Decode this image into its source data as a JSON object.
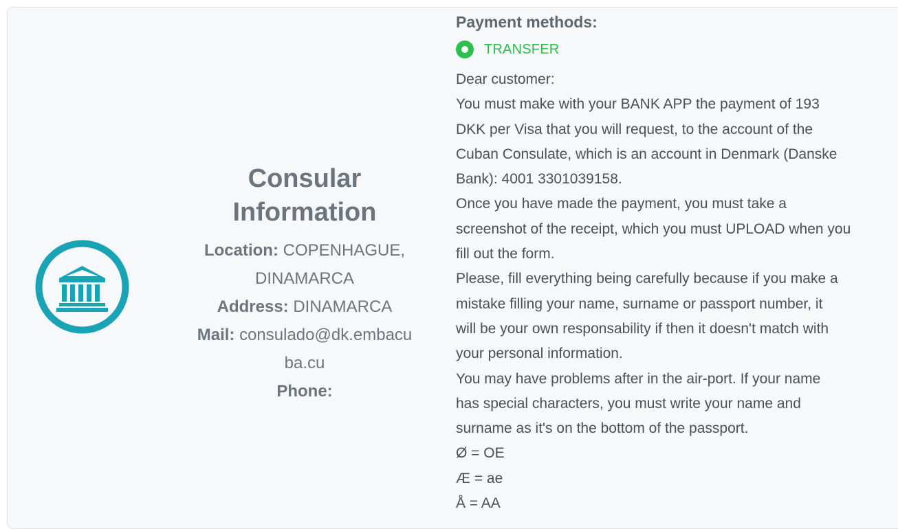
{
  "consular": {
    "title_line1": "Consular",
    "title_line2": "Information",
    "location_label": "Location:",
    "location_value": "COPENHAGUE,",
    "location_value2": "DINAMARCA",
    "address_label": "Address:",
    "address_value": "DINAMARCA",
    "mail_label": "Mail:",
    "mail_value": "consulado@dk.embacu",
    "mail_value2": "ba.cu",
    "phone_label": "Phone:",
    "icon": "bank-building-icon",
    "accent_color": "#1aa2b5"
  },
  "payment": {
    "title": "Payment methods:",
    "method_label": "TRANSFER",
    "method_color": "#2bbf4b",
    "lines": [
      "Dear customer:",
      "You must make with your BANK APP the payment of 193",
      "DKK per Visa that you will request, to the account of the",
      "Cuban Consulate, which is an account in Denmark (Danske",
      "Bank): 4001 3301039158.",
      "Once you have made the payment, you must take a",
      "screenshot of the receipt, which you must UPLOAD when you",
      "fill out the form.",
      "Please, fill everything being carefully because if you make a",
      "mistake filling your name, surname or passport number, it",
      "will be your own responsability if then it doesn't match with",
      "your personal information.",
      "You may have problems after in the air-port. If your name",
      "has special characters, you must write your name and",
      "surname as it's on the bottom of the passport.",
      "Ø = OE",
      "Æ = ae",
      "Å = AA"
    ]
  }
}
